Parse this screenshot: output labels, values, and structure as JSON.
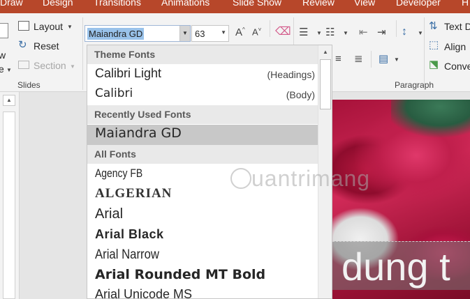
{
  "tabs": [
    "Draw",
    "Design",
    "Transitions",
    "Animations",
    "Slide Show",
    "Review",
    "View",
    "Developer",
    "H"
  ],
  "ribbon": {
    "slides_group": {
      "layout": "Layout",
      "reset": "Reset",
      "section": "Section",
      "label": "Slides",
      "left_partial_1": "w",
      "left_partial_2": "e"
    },
    "font_name": "Maiandra GD",
    "font_size": "63",
    "paragraph_label": "Paragraph",
    "right_items": [
      "Text D",
      "Align",
      "Conve"
    ]
  },
  "font_dropdown": {
    "theme_fonts_header": "Theme Fonts",
    "theme_fonts": [
      {
        "name": "Calibri Light",
        "tag": "(Headings)"
      },
      {
        "name": "Calibri",
        "tag": "(Body)"
      }
    ],
    "recent_header": "Recently Used Fonts",
    "recent_fonts": [
      "Maiandra GD"
    ],
    "all_header": "All Fonts",
    "all_fonts": [
      "Agency FB",
      "ALGERIAN",
      "Arial",
      "Arial Black",
      "Arial Narrow",
      "Arial Rounded MT Bold",
      "Arial Unicode MS"
    ]
  },
  "watermark": "uantrimang",
  "slide_title": "dung t",
  "colors": {
    "tab_bar": "#b7472a",
    "ribbon": "#f3f3f3",
    "selection": "#99c2ea",
    "selected_item": "#c8c8c8"
  }
}
